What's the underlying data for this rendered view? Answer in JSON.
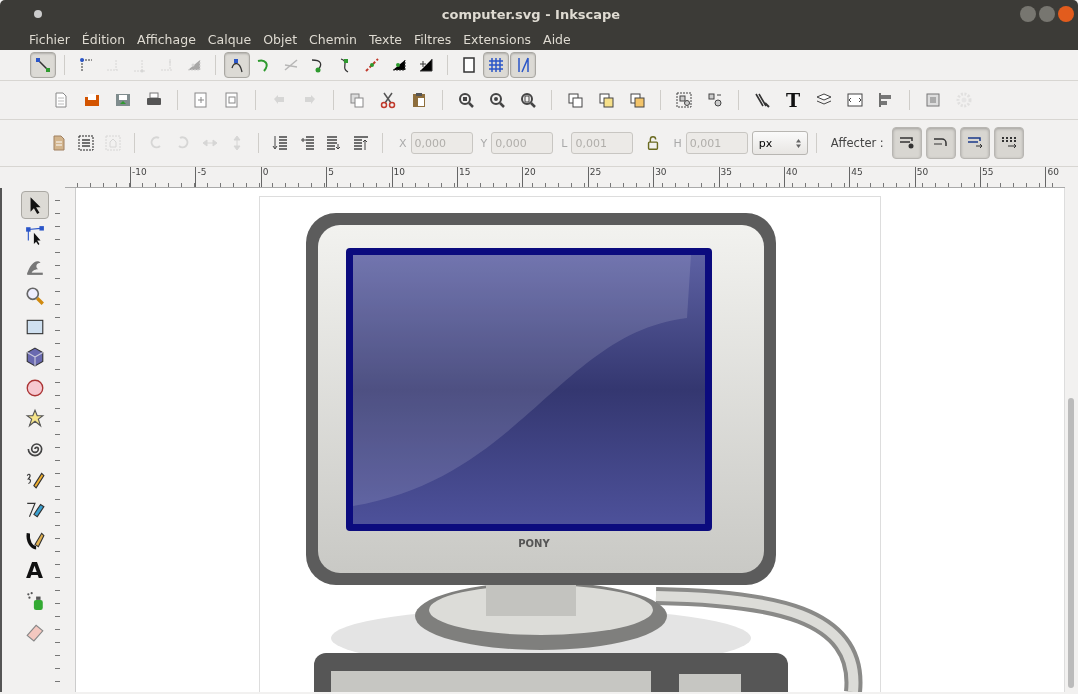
{
  "window": {
    "title": "computer.svg - Inkscape"
  },
  "menu": [
    "Fichier",
    "Édition",
    "Affichage",
    "Calque",
    "Objet",
    "Chemin",
    "Texte",
    "Filtres",
    "Extensions",
    "Aide"
  ],
  "snap_toolbar": [
    [
      {
        "selected": true,
        "disabled": false
      }
    ],
    [
      {
        "selected": false,
        "disabled": false
      },
      {
        "selected": false,
        "disabled": true
      },
      {
        "selected": false,
        "disabled": true
      },
      {
        "selected": false,
        "disabled": true
      },
      {
        "selected": false,
        "disabled": true
      }
    ],
    [
      {
        "selected": true,
        "disabled": false
      },
      {
        "selected": false,
        "disabled": false
      },
      {
        "selected": false,
        "disabled": true
      },
      {
        "selected": false,
        "disabled": false
      },
      {
        "selected": false,
        "disabled": false
      },
      {
        "selected": false,
        "disabled": false
      },
      {
        "selected": false,
        "disabled": false
      },
      {
        "selected": false,
        "disabled": false
      }
    ],
    [
      {
        "selected": false,
        "disabled": false
      },
      {
        "selected": true,
        "disabled": false
      },
      {
        "selected": true,
        "disabled": false
      }
    ]
  ],
  "commands_toolbar": [
    [
      {
        "disabled": false
      },
      {
        "disabled": false
      },
      {
        "disabled": false
      },
      {
        "disabled": false
      }
    ],
    [
      {
        "disabled": false
      },
      {
        "disabled": false
      }
    ],
    [
      {
        "disabled": true
      },
      {
        "disabled": true
      }
    ],
    [
      {
        "disabled": false
      },
      {
        "disabled": false
      },
      {
        "disabled": false
      }
    ],
    [
      {
        "disabled": false
      },
      {
        "disabled": false
      },
      {
        "disabled": false
      }
    ],
    [
      {
        "disabled": false
      },
      {
        "disabled": false
      },
      {
        "disabled": false
      }
    ],
    [
      {
        "disabled": false
      },
      {
        "disabled": false
      }
    ],
    [
      {
        "disabled": false
      },
      {
        "glyph": "T",
        "disabled": false
      },
      {
        "disabled": false
      },
      {
        "disabled": false
      },
      {
        "disabled": false
      }
    ],
    [
      {
        "disabled": false
      },
      {
        "disabled": true
      }
    ]
  ],
  "select_toolbar": {
    "groups": [
      [
        {
          "disabled": false
        },
        {
          "disabled": false
        },
        {
          "disabled": true
        }
      ],
      [
        {
          "disabled": true
        },
        {
          "disabled": true
        },
        {
          "disabled": true
        },
        {
          "disabled": true
        }
      ],
      [
        {
          "disabled": false
        },
        {
          "disabled": false
        },
        {
          "disabled": false
        },
        {
          "disabled": false
        }
      ]
    ],
    "fields": [
      {
        "kind": "field",
        "label": "X",
        "value": "0,000",
        "disabled": true
      },
      {
        "kind": "field",
        "label": "Y",
        "value": "0,000",
        "disabled": true
      },
      {
        "kind": "field",
        "label": "L",
        "value": "0,001",
        "disabled": true
      },
      {
        "kind": "lock",
        "locked": false
      },
      {
        "kind": "field",
        "label": "H",
        "value": "0,001",
        "disabled": true
      }
    ],
    "unit": "px",
    "affect_label": "Affecter :",
    "affect_buttons": [
      {
        "selected": true
      },
      {
        "selected": true
      },
      {
        "selected": true
      },
      {
        "selected": true
      }
    ]
  },
  "ruler": [
    "-10",
    "-5",
    "0",
    "5",
    "10",
    "15",
    "20",
    "25",
    "30",
    "35",
    "40",
    "45",
    "50",
    "55",
    "60"
  ],
  "toolbox": [
    {
      "selected": true
    },
    {
      "selected": false
    },
    {
      "selected": false
    },
    {
      "selected": false
    },
    {
      "selected": false
    },
    {
      "selected": false
    },
    {
      "selected": false
    },
    {
      "selected": false
    },
    {
      "selected": false
    },
    {
      "selected": false
    },
    {
      "selected": false
    },
    {
      "selected": false
    },
    {
      "glyph": "A",
      "selected": false
    },
    {
      "selected": false
    },
    {
      "selected": false
    }
  ],
  "canvas": {
    "drawing_label": "PONY"
  }
}
